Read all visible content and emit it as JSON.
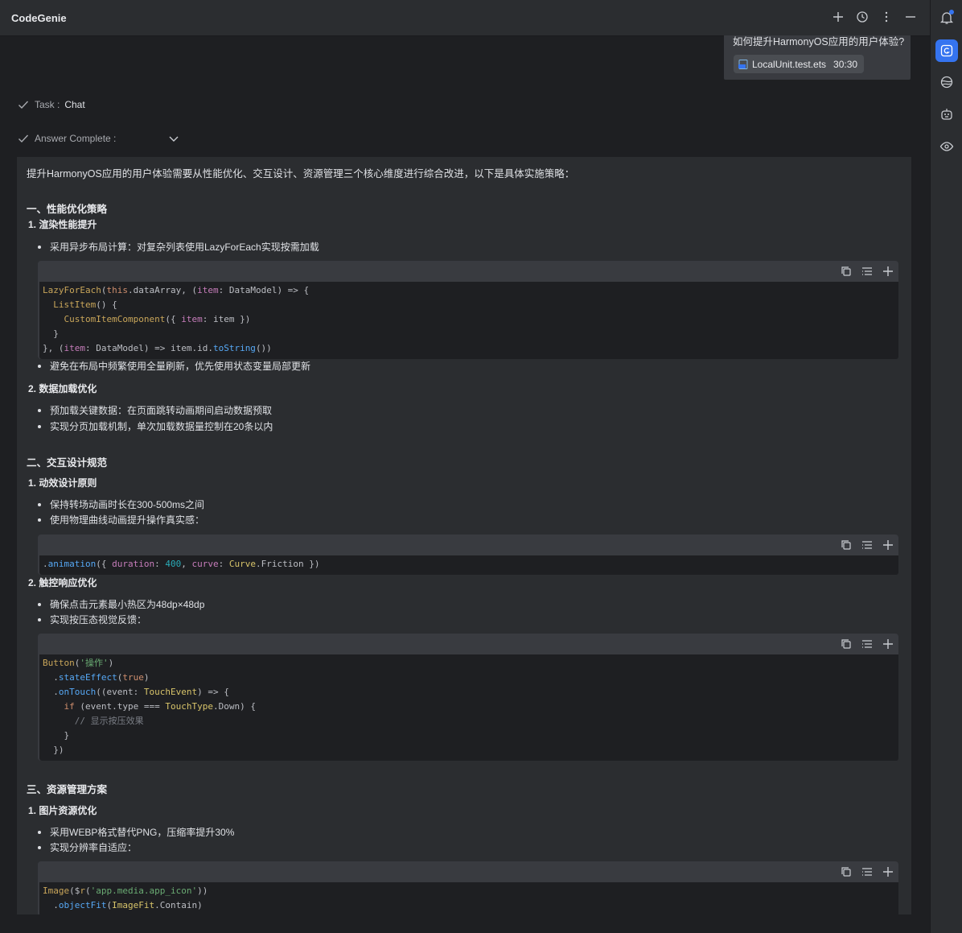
{
  "header": {
    "title": "CodeGenie"
  },
  "user_message": {
    "question": "如何提升HarmonyOS应用的用户体验?",
    "file": {
      "name": "LocalUnit.test.ets",
      "line": "30:30"
    }
  },
  "status": {
    "task_label": "Task :",
    "task_value": "Chat",
    "answer_label": "Answer Complete :"
  },
  "answer": {
    "intro": "提升HarmonyOS应用的用户体验需要从性能优化、交互设计、资源管理三个核心维度进行综合改进，以下是具体实施策略：",
    "sections": [
      {
        "title": "一、性能优化策略",
        "subs": [
          {
            "title": "1. 渲染性能提升",
            "bullets_before": [
              "采用异步布局计算：对复杂列表使用LazyForEach实现按需加载"
            ],
            "bullets_after": [
              "避免在布局中频繁使用全量刷新，优先使用状态变量局部更新"
            ]
          },
          {
            "title": "2. 数据加载优化",
            "bullets": [
              "预加载关键数据：在页面跳转动画期间启动数据预取",
              "实现分页加载机制，单次加载数据量控制在20条以内"
            ]
          }
        ]
      },
      {
        "title": "二、交互设计规范",
        "subs": [
          {
            "title": "1. 动效设计原则",
            "bullets": [
              "保持转场动画时长在300-500ms之间",
              "使用物理曲线动画提升操作真实感："
            ]
          },
          {
            "title": "2. 触控响应优化",
            "bullets": [
              "确保点击元素最小热区为48dp×48dp",
              "实现按压态视觉反馈："
            ]
          }
        ]
      },
      {
        "title": "三、资源管理方案",
        "subs": [
          {
            "title": "1. 图片资源优化",
            "bullets": [
              "采用WEBP格式替代PNG，压缩率提升30%",
              "实现分辨率自适应："
            ]
          }
        ]
      }
    ]
  },
  "code_blocks": [
    "LazyForEach(this.dataArray, (item: DataModel) => {\n  ListItem() {\n    CustomItemComponent({ item: item })\n  }\n}, (item: DataModel) => item.id.toString())",
    ".animation({ duration: 400, curve: Curve.Friction })",
    "Button('操作')\n  .stateEffect(true)\n  .onTouch((event: TouchEvent) => {\n    if (event.type === TouchType.Down) {\n      // 显示按压效果\n    }\n  })",
    "Image($r('app.media.app_icon'))\n  .objectFit(ImageFit.Contain)"
  ],
  "icons": {
    "toolbar": [
      "plus-icon",
      "history-icon",
      "more-vertical-icon",
      "minimize-icon"
    ],
    "sidebar": [
      "notification-bell-icon",
      "codegenie-icon",
      "globe-icon",
      "agent-icon",
      "eye-icon"
    ],
    "code_actions": [
      "copy-icon",
      "insert-icon",
      "add-icon"
    ]
  },
  "colors": {
    "accent": "#3574f0",
    "panel": "#2b2d30",
    "background": "#1e1f22"
  }
}
